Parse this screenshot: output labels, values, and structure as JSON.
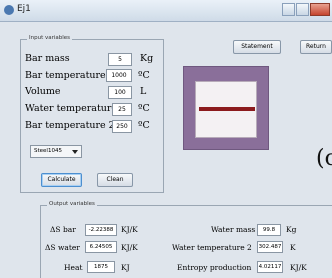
{
  "window": {
    "title": "Ej1"
  },
  "input_panel": {
    "legend": "Input variables",
    "rows": [
      {
        "label": "Bar mass",
        "value": "5",
        "unit": "Kg"
      },
      {
        "label": "Bar temperature",
        "value": "1000",
        "unit": "ºC"
      },
      {
        "label": "Volume",
        "value": "100",
        "unit": "L"
      },
      {
        "label": "Water temperature",
        "value": "25",
        "unit": "ºC"
      },
      {
        "label": "Bar temperature 2",
        "value": "250",
        "unit": "ºC"
      }
    ],
    "material_select": "Steel1045",
    "calculate_label": "Calculate",
    "clean_label": "Clean"
  },
  "toolbar": {
    "statement_label": "Statement",
    "return_label": "Return"
  },
  "clipped_text": "(c",
  "output_panel": {
    "legend": "Output variables",
    "left": [
      {
        "label": "ΔS bar",
        "value": "-2.22388",
        "unit": "KJ/K"
      },
      {
        "label": "ΔS water",
        "value": "6.24505",
        "unit": "KJ/K"
      },
      {
        "label": "Heat",
        "value": "1875",
        "unit": "KJ"
      }
    ],
    "right": [
      {
        "label": "Water mass",
        "value": "99.8",
        "unit": "Kg"
      },
      {
        "label": "Water temperature 2",
        "value": "302.487",
        "unit": "K"
      },
      {
        "label": "Entropy production",
        "value": "4.02117",
        "unit": "KJ/K"
      }
    ]
  },
  "colors": {
    "bar": "#8c1b1d",
    "container": "#8a6f9a",
    "background": "#dfe5ec"
  }
}
